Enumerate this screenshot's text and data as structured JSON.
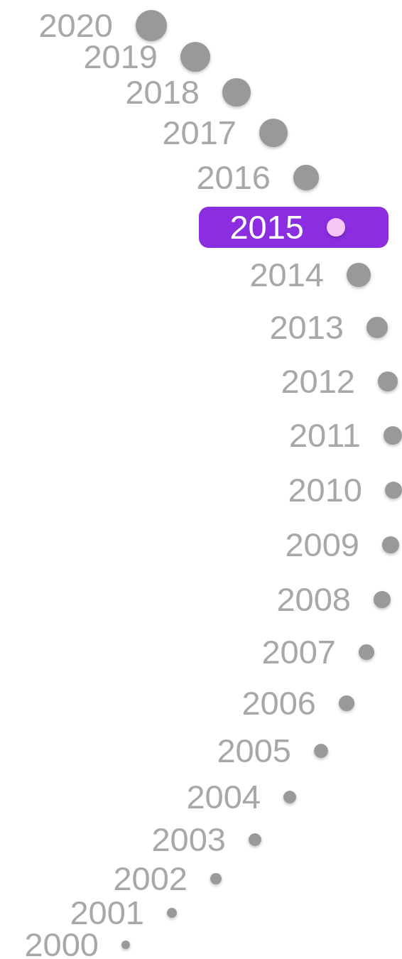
{
  "years": [
    {
      "label": "2020",
      "selected": false
    },
    {
      "label": "2019",
      "selected": false
    },
    {
      "label": "2018",
      "selected": false
    },
    {
      "label": "2017",
      "selected": false
    },
    {
      "label": "2016",
      "selected": false
    },
    {
      "label": "2015",
      "selected": true
    },
    {
      "label": "2014",
      "selected": false
    },
    {
      "label": "2013",
      "selected": false
    },
    {
      "label": "2012",
      "selected": false
    },
    {
      "label": "2011",
      "selected": false
    },
    {
      "label": "2010",
      "selected": false
    },
    {
      "label": "2009",
      "selected": false
    },
    {
      "label": "2008",
      "selected": false
    },
    {
      "label": "2007",
      "selected": false
    },
    {
      "label": "2006",
      "selected": false
    },
    {
      "label": "2005",
      "selected": false
    },
    {
      "label": "2004",
      "selected": false
    },
    {
      "label": "2003",
      "selected": false
    },
    {
      "label": "2002",
      "selected": false
    },
    {
      "label": "2001",
      "selected": false
    },
    {
      "label": "2000",
      "selected": false
    }
  ]
}
